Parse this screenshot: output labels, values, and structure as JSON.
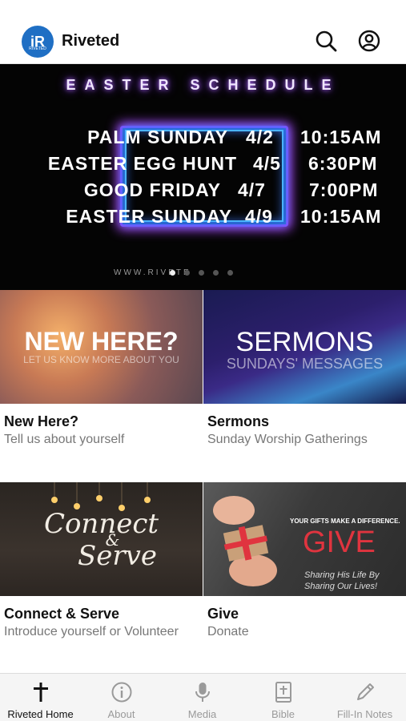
{
  "header": {
    "app_name": "Riveted",
    "logo_letters": "iR",
    "logo_subtext": "RIVETED",
    "search_icon": "search-icon",
    "profile_icon": "user-circle-icon"
  },
  "hero": {
    "heading": "EASTER SCHEDULE",
    "rows": [
      {
        "event": "PALM SUNDAY",
        "date": "4/2",
        "time": "10:15AM"
      },
      {
        "event": "EASTER EGG HUNT",
        "date": "4/5",
        "time": "6:30PM"
      },
      {
        "event": "GOOD FRIDAY",
        "date": "4/7",
        "time": "7:00PM"
      },
      {
        "event": "EASTER SUNDAY",
        "date": "4/9",
        "time": "10:15AM"
      }
    ],
    "url": "WWW.RIVETE",
    "carousel_count": 5,
    "carousel_active": 0
  },
  "cards": [
    {
      "overlay_big": "NEW HERE?",
      "overlay_small": "LET US KNOW MORE ABOUT YOU",
      "title": "New Here?",
      "subtitle": "Tell us about yourself"
    },
    {
      "overlay_big": "SERMONS",
      "overlay_small": "SUNDAYS' MESSAGES",
      "title": "Sermons",
      "subtitle": "Sunday Worship Gatherings"
    },
    {
      "overlay_big": "Connect",
      "overlay_amp": "&",
      "overlay_small": "Serve",
      "title": "Connect & Serve",
      "subtitle": "Introduce yourself or Volunteer"
    },
    {
      "overlay_top": "YOUR GIFTS MAKE A DIFFERENCE.",
      "overlay_big": "GIVE",
      "overlay_small_1": "Sharing His Life By",
      "overlay_small_2": "Sharing Our Lives!",
      "title": "Give",
      "subtitle": "Donate"
    }
  ],
  "tabs": [
    {
      "label": "Riveted Home",
      "icon": "cross-icon",
      "active": true
    },
    {
      "label": "About",
      "icon": "info-icon",
      "active": false
    },
    {
      "label": "Media",
      "icon": "microphone-icon",
      "active": false
    },
    {
      "label": "Bible",
      "icon": "bible-icon",
      "active": false
    },
    {
      "label": "Fill-In Notes",
      "icon": "pencil-icon",
      "active": false
    }
  ],
  "colors": {
    "brand_blue": "#1f6fc4",
    "neon_purple": "#b04cff",
    "neon_blue": "#4ab4ff",
    "give_red": "#e0343f"
  }
}
